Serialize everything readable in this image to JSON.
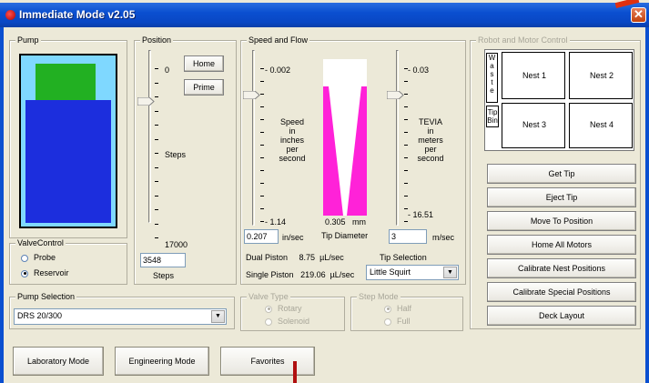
{
  "window": {
    "title": "Immediate Mode v2.05",
    "close_glyph": "✕"
  },
  "pump": {
    "label": "Pump",
    "colors": {
      "frame": "#000000",
      "syringe_border": "#7fd8ff",
      "fill_top": "#22b022",
      "fill_bottom": "#1c2edd"
    }
  },
  "valve": {
    "label": "ValveControl",
    "probe": "Probe",
    "reservoir": "Reservoir",
    "selected": "Reservoir"
  },
  "position": {
    "label": "Position",
    "top_value": "0",
    "bottom_value": "17000",
    "steps_label": "Steps",
    "steps_value": "3548",
    "steps_unit": "Steps",
    "home": "Home",
    "prime": "Prime"
  },
  "speed": {
    "label": "Speed and Flow",
    "left_top": "0.002",
    "left_bottom": "1.14",
    "left_caption": [
      "Speed",
      "in",
      "inches",
      "per",
      "second"
    ],
    "left_value": "0.207",
    "left_unit": "in/sec",
    "tip_diameter_value": "0.305",
    "tip_diameter_unit": "mm",
    "tip_diameter_label": "Tip Diameter",
    "right_top": "0.03",
    "right_bottom": "16.51",
    "right_caption": [
      "TEVIA",
      "in",
      "meters",
      "per",
      "second"
    ],
    "right_value": "3",
    "right_unit": "m/sec",
    "dual_piston_label": "Dual Piston",
    "dual_piston_value": "8.75",
    "dual_piston_unit": "µL/sec",
    "single_piston_label": "Single Piston",
    "single_piston_value": "219.06",
    "single_piston_unit": "µL/sec",
    "tip_selection_label": "Tip Selection",
    "tip_selection_value": "Little Squirt",
    "tip_color": "#ff22d8"
  },
  "pump_selection": {
    "label": "Pump Selection",
    "value": "DRS 20/300"
  },
  "valve_type": {
    "label": "Valve Type",
    "rotary": "Rotary",
    "solenoid": "Solenoid"
  },
  "step_mode": {
    "label": "Step Mode",
    "half": "Half",
    "full": "Full"
  },
  "robot": {
    "label": "Robot and Motor Control",
    "waste_letters": [
      "W",
      "a",
      "s",
      "t",
      "e"
    ],
    "tip_bin": [
      "Tip",
      "Bin"
    ],
    "nests": [
      "Nest 1",
      "Nest 2",
      "Nest 3",
      "Nest 4"
    ],
    "buttons": [
      "Get Tip",
      "Eject Tip",
      "Move To Position",
      "Home All Motors",
      "Calibrate Nest Positions",
      "Calibrate Special Positions",
      "Deck Layout"
    ]
  },
  "bottom": {
    "laboratory": "Laboratory Mode",
    "engineering": "Engineering Mode",
    "favorites": "Favorites"
  },
  "icons": {
    "close": "close-icon",
    "app": "app-icon",
    "dropdown": "chevron-down-icon"
  }
}
